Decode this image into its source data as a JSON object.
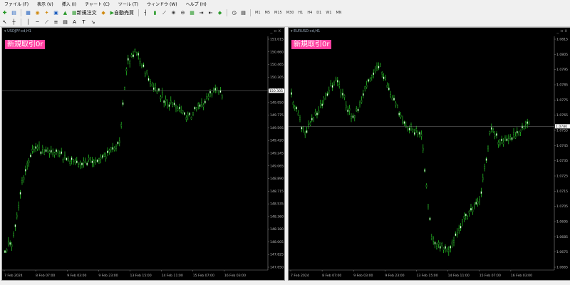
{
  "menu": [
    "ファイル (F)",
    "表示 (V)",
    "挿入 (I)",
    "チャート (C)",
    "ツール (T)",
    "ウィンドウ (W)",
    "ヘルプ (H)"
  ],
  "toolbar": {
    "new_order_label": "新規注文",
    "autotrade_label": "自動売買",
    "timeframes": [
      "M1",
      "M5",
      "M15",
      "M30",
      "H1",
      "H4",
      "D1",
      "W1",
      "MN"
    ]
  },
  "charts": [
    {
      "title": "USDJPY-cd,H1",
      "badge": "新規取引0r",
      "price_axis": [
        "151.015",
        "150.660",
        "150.465",
        "150.305",
        "150.130",
        "149.950",
        "149.775",
        "149.595",
        "149.420",
        "149.245",
        "149.065",
        "148.890",
        "148.715",
        "148.535",
        "148.360",
        "148.180",
        "148.005",
        "147.825",
        "147.650"
      ],
      "current_price": "150.305",
      "time_axis": [
        "7 Feb 2024",
        "8 Feb 07:00",
        "9 Feb 03:00",
        "9 Feb 23:00",
        "13 Feb 15:00",
        "14 Feb 11:00",
        "15 Feb 07:00",
        "16 Feb 03:00"
      ],
      "bar_color": "#26d026"
    },
    {
      "title": "EURUSD-cd,H1",
      "badge": "新規取引0r",
      "price_axis": [
        "1.0815",
        "1.0805",
        "1.0795",
        "1.0785",
        "1.0775",
        "1.0765",
        "1.0755",
        "1.0745",
        "1.0735",
        "1.0725",
        "1.0715",
        "1.0705",
        "1.0695",
        "1.0685",
        "1.0675",
        "1.0665"
      ],
      "current_price": "1.0780",
      "time_axis": [
        "7 Feb 2024",
        "8 Feb 07:00",
        "9 Feb 03:00",
        "9 Feb 23:00",
        "13 Feb 15:00",
        "14 Feb 11:00",
        "15 Feb 07:00",
        "16 Feb 03:00"
      ],
      "bar_color": "#26d026"
    }
  ]
}
